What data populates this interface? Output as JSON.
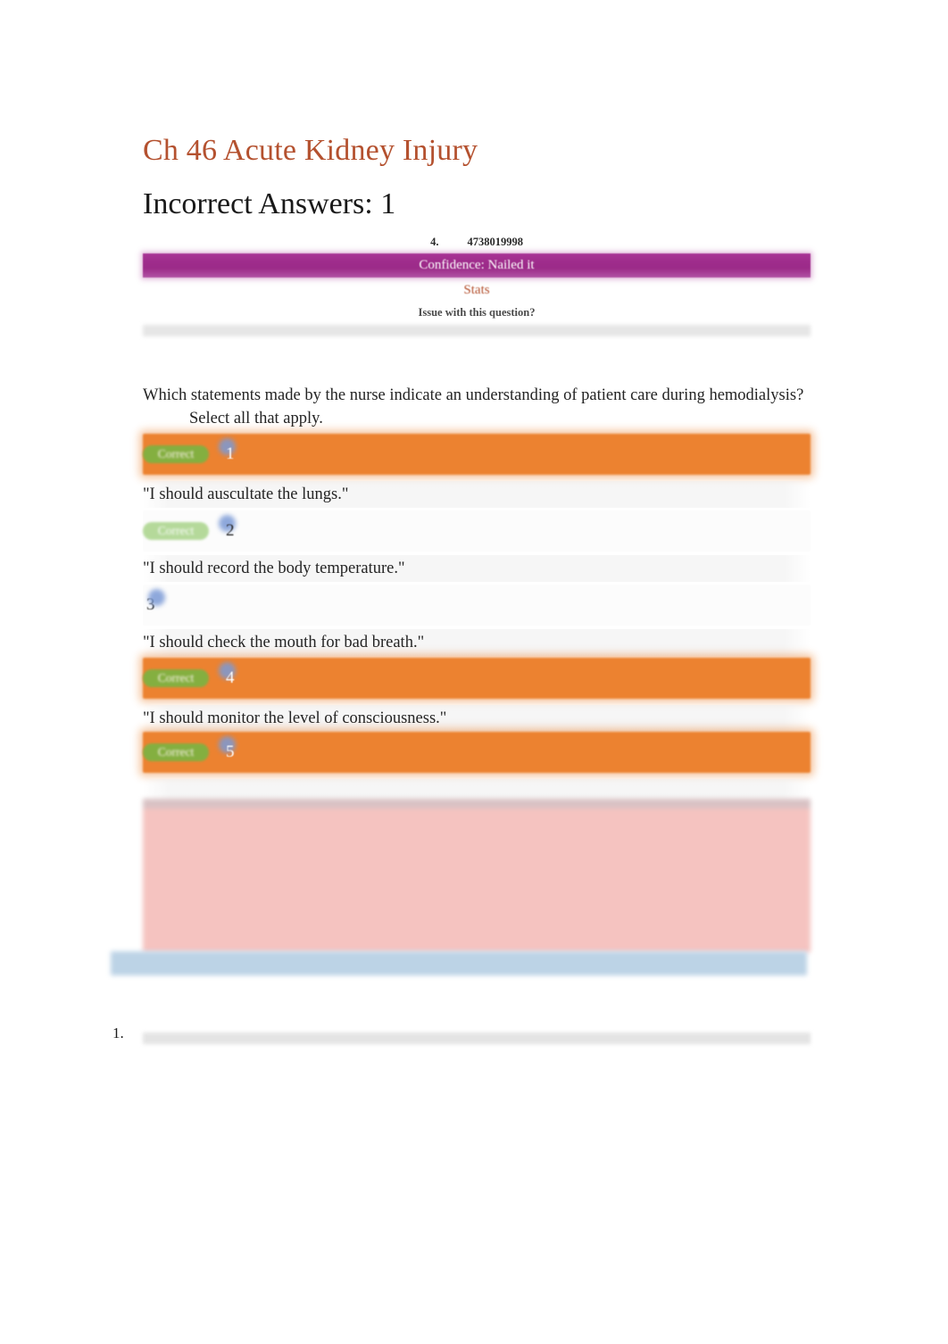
{
  "document": {
    "title": "Ch 46 Acute Kidney Injury",
    "subtitle": "Incorrect Answers: 1"
  },
  "question_header": {
    "question_number": "4.",
    "question_id": "4738019998",
    "confidence_label": "Confidence: Nailed it",
    "stats_link": "Stats",
    "issue_link": "Issue with this question?"
  },
  "question": {
    "stem": "Which statements made by the nurse indicate an understanding of patient care during hemodialysis?",
    "instruction": "Select all that apply."
  },
  "options": [
    {
      "index": "1",
      "badge": "Correct",
      "answer_text": "\"I should auscultate the lungs.\"",
      "highlight": "orange"
    },
    {
      "index": "2",
      "badge": "Correct",
      "answer_text": "\"I should record the body temperature.\"",
      "highlight": "none"
    },
    {
      "index": "3",
      "badge": "",
      "answer_text": "\"I should check the mouth for bad breath.\"",
      "highlight": "none"
    },
    {
      "index": "4",
      "badge": "Correct",
      "answer_text": "\"I should monitor the level of consciousness.\"",
      "highlight": "orange"
    },
    {
      "index": "5",
      "badge": "Correct",
      "answer_text": "",
      "highlight": "orange"
    }
  ],
  "footer": {
    "list_marker": "1."
  },
  "colors": {
    "title": "#b4512f",
    "confidence_bar": "#9e2c8b",
    "correct_badge": "#7cb342",
    "selected_highlight": "#ec8230",
    "redacted_block": "#f5c3c0",
    "blue_bar": "#bcd3e6",
    "option_dot": "#7b9ad6"
  }
}
